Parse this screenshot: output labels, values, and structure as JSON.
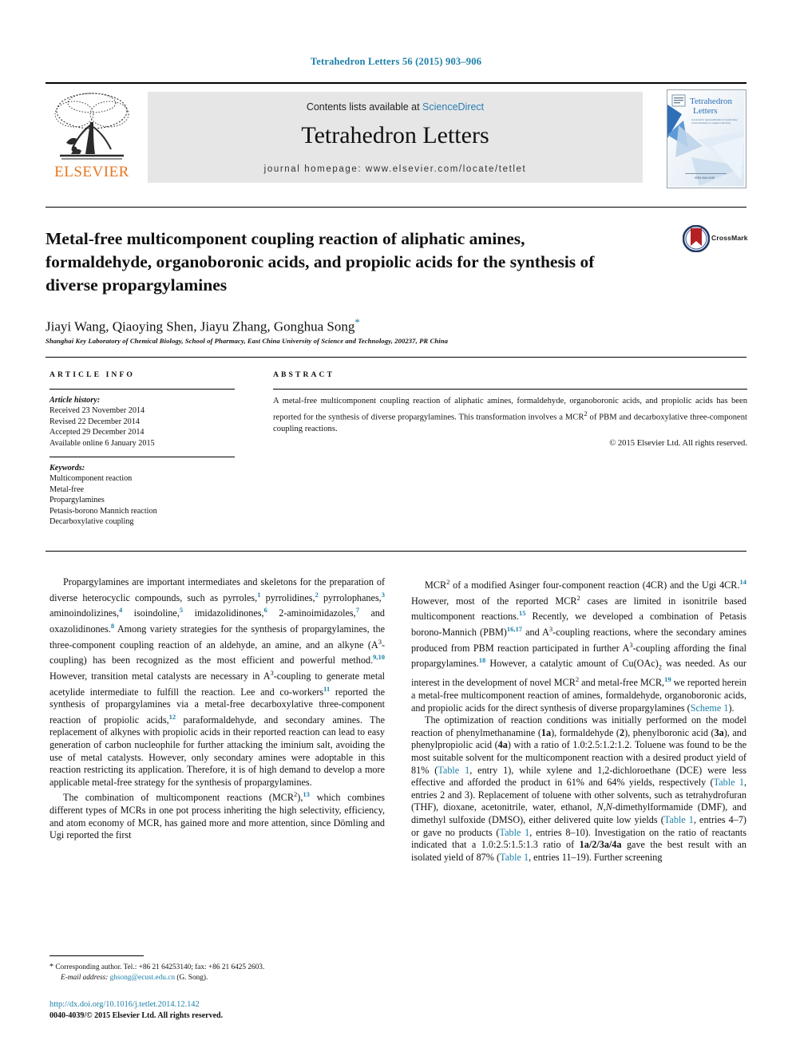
{
  "running_head": "Tetrahedron Letters 56 (2015) 903–906",
  "masthead": {
    "contents_prefix": "Contents lists available at ",
    "sciencedirect": "ScienceDirect",
    "journal_name": "Tetrahedron Letters",
    "homepage": "journal homepage: www.elsevier.com/locate/tetlet",
    "publisher_wordmark": "ELSEVIER",
    "cover_title_line1": "Tetrahedron",
    "cover_title_line2": "Letters",
    "cover_subtitle": "A journal for rapid publication of preliminary communications in organic chemistry",
    "cover_footer": "ISSN 0040-4039"
  },
  "article": {
    "title": "Metal-free multicomponent coupling reaction of aliphatic amines, formaldehyde, organoboronic acids, and propiolic acids for the synthesis of diverse propargylamines",
    "authors": "Jiayi Wang, Qiaoying Shen, Jiayu Zhang, Gonghua Song",
    "corresponding_marker": "*",
    "affiliation": "Shanghai Key Laboratory of Chemical Biology, School of Pharmacy, East China University of Science and Technology, 200237, PR China",
    "crossmark_label": "CrossMark"
  },
  "info": {
    "heading": "ARTICLE INFO",
    "history_label": "Article history:",
    "history": [
      "Received 23 November 2014",
      "Revised 22 December 2014",
      "Accepted 29 December 2014",
      "Available online 6 January 2015"
    ],
    "keywords_label": "Keywords:",
    "keywords": [
      "Multicomponent reaction",
      "Metal-free",
      "Propargylamines",
      "Petasis-borono Mannich reaction",
      "Decarboxylative coupling"
    ]
  },
  "abstract": {
    "heading": "ABSTRACT",
    "text_part1": "A metal-free multicomponent coupling reaction of aliphatic amines, formaldehyde, organoboronic acids, and propiolic acids has been reported for the synthesis of diverse propargylamines. This transformation involves a MCR",
    "text_sup": "2",
    "text_part2": " of PBM and decarboxylative three-component coupling reactions.",
    "copyright": "© 2015 Elsevier Ltd. All rights reserved."
  },
  "body": {
    "left_paragraphs": [
      "Propargylamines are important intermediates and skeletons for the preparation of diverse heterocyclic compounds, such as pyrroles,|1| pyrrolidines,|2| pyrrolophanes,|3| aminoindolizines,|4| isoindoline,|5| imidazolidinones,|6| 2-aminoimidazoles,|7| and oxazolidinones.|8| Among variety strategies for the synthesis of propargylamines, the three-component coupling reaction of an aldehyde, an amine, and an alkyne (A^3-coupling) has been recognized as the most efficient and powerful method.|9,10| However, transition metal catalysts are necessary in A^3-coupling to generate metal acetylide intermediate to fulfill the reaction. Lee and co-workers|11| reported the synthesis of propargylamines via a metal-free decarboxylative three-component reaction of propiolic acids,|12| paraformaldehyde, and secondary amines. The replacement of alkynes with propiolic acids in their reported reaction can lead to easy generation of carbon nucleophile for further attacking the iminium salt, avoiding the use of metal catalysts. However, only secondary amines were adoptable in this reaction restricting its application. Therefore, it is of high demand to develop a more applicable metal-free strategy for the synthesis of propargylamines.",
      "The combination of multicomponent reactions (MCR^2),|13| which combines different types of MCRs in one pot process inheriting the high selectivity, efficiency, and atom economy of MCR, has gained more and more attention, since Dömling and Ugi reported the first"
    ],
    "right_paragraphs": [
      "MCR^2 of a modified Asinger four-component reaction (4CR) and the Ugi 4CR.|14| However, most of the reported MCR^2 cases are limited in isonitrile based multicomponent reactions.|15| Recently, we developed a combination of Petasis borono-Mannich (PBM)|16,17| and A^3-coupling reactions, where the secondary amines produced from PBM reaction participated in further A^3-coupling affording the final propargylamines.|18| However, a catalytic amount of Cu(OAc)_2 was needed. As our interest in the development of novel MCR^2 and metal-free MCR,|19| we reported herein a metal-free multicomponent reaction of amines, formaldehyde, organoboronic acids, and propiolic acids for the direct synthesis of diverse propargylamines (Scheme 1).",
      "The optimization of reaction conditions was initially performed on the model reaction of phenylmethanamine (1a), formaldehyde (2), phenylboronic acid (3a), and phenylpropiolic acid (4a) with a ratio of 1.0:2.5:1.2:1.2. Toluene was found to be the most suitable solvent for the multicomponent reaction with a desired product yield of 81% (Table 1, entry 1), while xylene and 1,2-dichloroethane (DCE) were less effective and afforded the product in 61% and 64% yields, respectively (Table 1, entries 2 and 3). Replacement of toluene with other solvents, such as tetrahydrofuran (THF), dioxane, acetonitrile, water, ethanol, N,N-dimethylformamide (DMF), and dimethyl sulfoxide (DMSO), either delivered quite low yields (Table 1, entries 4–7) or gave no products (Table 1, entries 8–10). Investigation on the ratio of reactants indicated that a 1.0:2.5:1.5:1.3 ratio of 1a/2/3a/4a gave the best result with an isolated yield of 87% (Table 1, entries 11–19). Further screening"
    ]
  },
  "footnote": {
    "marker": "*",
    "corresponding": "Corresponding author. Tel.: +86 21 64253140; fax: +86 21 6425 2603.",
    "email_label": "E-mail address:",
    "email": "ghsong@ecust.edu.cn",
    "email_owner": "(G. Song)."
  },
  "footer": {
    "doi": "http://dx.doi.org/10.1016/j.tetlet.2014.12.142",
    "issn_line": "0040-4039/© 2015 Elsevier Ltd. All rights reserved."
  },
  "colors": {
    "link": "#1b7fa8",
    "sciencedirect": "#2b7db5",
    "elsevier_orange": "#e87722",
    "masthead_gray": "#e6e6e6"
  }
}
